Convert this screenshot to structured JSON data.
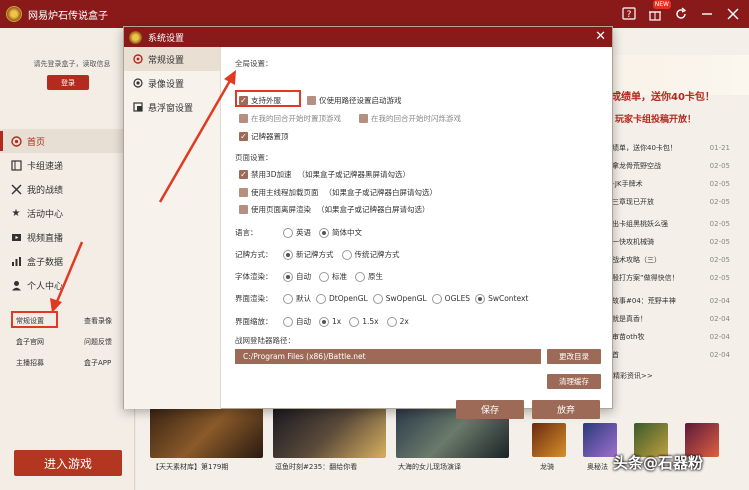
{
  "app": {
    "title": "网易炉石传说盒子"
  },
  "titlebar_icons": [
    "help-icon",
    "gift-icon",
    "refresh-icon",
    "minimize-icon",
    "close-icon"
  ],
  "titlebar_badge": "NEW",
  "sidebar": {
    "login_tip": "请先登录盒子，读取信息",
    "login_label": "登录",
    "items": [
      {
        "label": "首页",
        "icon": "home-icon"
      },
      {
        "label": "卡组速递",
        "icon": "deck-icon"
      },
      {
        "label": "我的战绩",
        "icon": "sword-icon"
      },
      {
        "label": "活动中心",
        "icon": "star-icon"
      },
      {
        "label": "视频直播",
        "icon": "video-icon"
      },
      {
        "label": "盒子数据",
        "icon": "chart-icon"
      },
      {
        "label": "个人中心",
        "icon": "user-icon"
      }
    ],
    "links": {
      "settings": "常规设置",
      "view_recording": "查看录像",
      "box_site": "盒子官网",
      "feedback": "问题反馈",
      "anchor_recruit": "主播招募",
      "box_app": "盒子APP"
    },
    "enter_game": "进入游戏"
  },
  "background": {
    "banner_text": "成绩单，送你40卡包！",
    "banner_text2": "玩家卡组投稿开放！",
    "news": [
      {
        "title": "绩单，送你40卡包！",
        "date": "01-21"
      },
      {
        "title": "拿龙骨荒野空战",
        "date": "02-05"
      },
      {
        "title": "-JK手牌术",
        "date": "02-05"
      },
      {
        "title": "三章现已开放",
        "date": "02-05"
      },
      {
        "title": "出卡组黑桃妖么强",
        "date": "02-05"
      },
      {
        "title": "一快攻机械骑",
        "date": "02-05"
      },
      {
        "title": "战术攻略（三）",
        "date": "02-05"
      },
      {
        "title": "殷打方案”做得快信！",
        "date": "02-05"
      },
      {
        "title": "故事#04：荒野丰神",
        "date": "02-04"
      },
      {
        "title": "就是真香！",
        "date": "02-04"
      },
      {
        "title": "审苗oth牧",
        "date": "02-04"
      },
      {
        "title": "首",
        "date": "02-04"
      }
    ],
    "more": "精彩资讯>>",
    "thumb_captions": [
      "【天天素材库】第179期",
      "逗鱼时刻#235：翻给你看",
      "大海的女儿现场演译"
    ],
    "heroes": [
      "龙骑",
      "奥秘法",
      "",
      ""
    ],
    "watermark": "头条@石器粉"
  },
  "dialog": {
    "title": "系统设置",
    "tabs": [
      {
        "label": "常规设置",
        "icon": "settings-icon"
      },
      {
        "label": "录像设置",
        "icon": "record-icon"
      },
      {
        "label": "悬浮窗设置",
        "icon": "window-icon"
      }
    ],
    "global": {
      "title": "全局设置：",
      "support_outside": "支持外服",
      "path_only": "仅使用路径设置启动游戏",
      "my_turn_top": "在我的回合开始时置顶游戏",
      "my_turn_flash": "在我的回合开始时闪烁游戏",
      "tracker_top": "记牌器置顶"
    },
    "page": {
      "title": "页面设置：",
      "hw_accel": "禁用3D加速",
      "hw_accel_note": "（如果盒子或记牌器黑屏请勾选）",
      "main_thread": "使用主线程加载页面",
      "main_thread_note": "（如果盒子或记牌器白屏请勾选）",
      "offscreen": "使用页面离屏渲染",
      "offscreen_note": "（如果盒子或记牌器白屏请勾选）"
    },
    "language": {
      "label": "语言：",
      "options": [
        "英语",
        "简体中文"
      ],
      "selected": "简体中文"
    },
    "tracker_mode": {
      "label": "记牌方式：",
      "options": [
        "新记牌方式",
        "传统记牌方式"
      ],
      "selected": "新记牌方式"
    },
    "font_render": {
      "label": "字体渲染：",
      "options": [
        "自动",
        "标准",
        "原生"
      ],
      "selected": "自动"
    },
    "ui_render": {
      "label": "界面渲染：",
      "options": [
        "默认",
        "DtOpenGL",
        "SwOpenGL",
        "OGLES",
        "SwContext"
      ],
      "selected": "SwContext"
    },
    "ui_scale": {
      "label": "界面缩放：",
      "options": [
        "自动",
        "1x",
        "1.5x",
        "2x"
      ],
      "selected": "1x"
    },
    "path": {
      "label": "战网登陆器路径：",
      "value": "C:/Program Files (x86)/Battle.net",
      "change_label": "更改目录",
      "clear_cache_label": "清理缓存"
    },
    "save_label": "保存",
    "cancel_label": "放弃"
  }
}
